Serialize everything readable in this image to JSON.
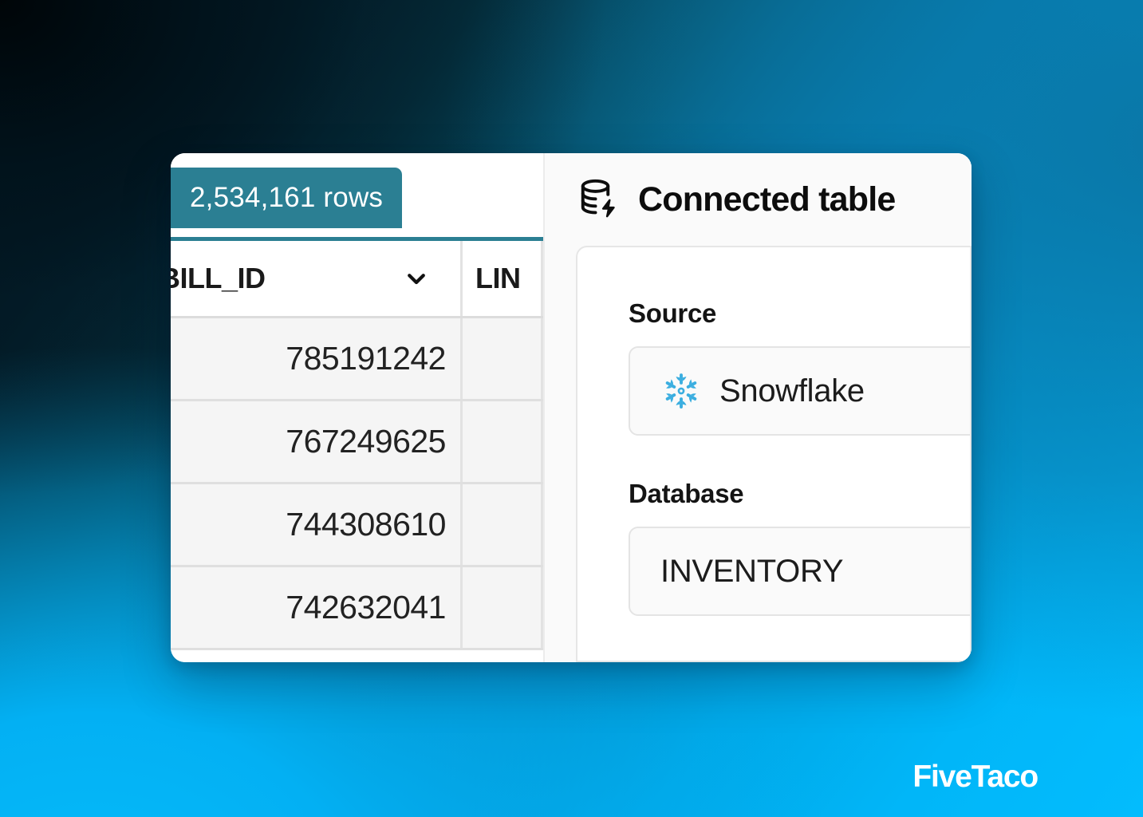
{
  "background": {
    "dark_corner_color": "#02131C",
    "mid_color": "#0A76A6",
    "bright_color": "#03BCFD"
  },
  "grid": {
    "rows_badge": "2,534,161 rows",
    "badge_color": "#2B7F93",
    "columns": [
      {
        "id": "bill-id",
        "label": "BILL_ID",
        "has_sort_menu": true,
        "sort_icon": "chevron-down-icon"
      },
      {
        "id": "lin",
        "label": "LIN",
        "has_sort_menu": false
      }
    ],
    "rows": [
      {
        "bill_id": "785191242",
        "lin": ""
      },
      {
        "bill_id": "767249625",
        "lin": ""
      },
      {
        "bill_id": "744308610",
        "lin": ""
      },
      {
        "bill_id": "742632041",
        "lin": ""
      }
    ]
  },
  "details": {
    "icon": "database-lightning-icon",
    "title": "Connected table",
    "fields": [
      {
        "label": "Source",
        "value": "Snowflake",
        "icon": "snowflake-icon",
        "icon_color": "#3BAEE0"
      },
      {
        "label": "Database",
        "value": "INVENTORY",
        "icon": null
      }
    ]
  },
  "watermark": {
    "text": "FiveTaco",
    "color": "#FFFFFF"
  }
}
